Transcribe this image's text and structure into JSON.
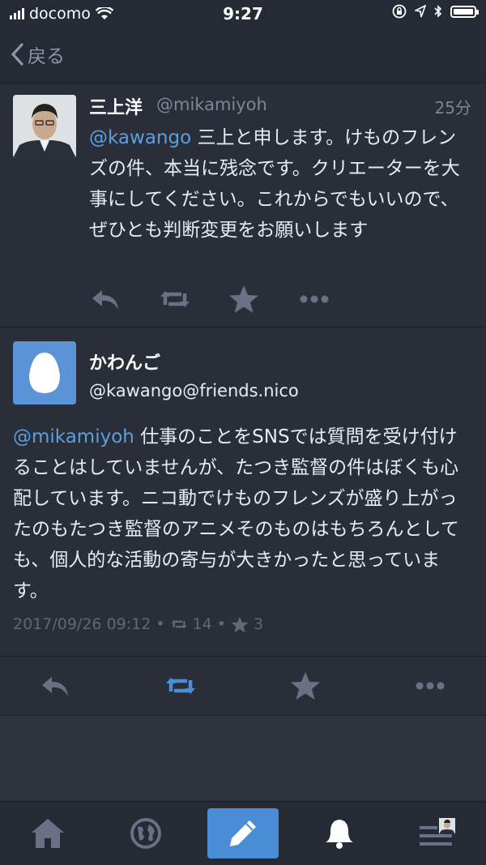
{
  "status_bar": {
    "carrier": "docomo",
    "time": "9:27"
  },
  "nav": {
    "back_label": "戻る"
  },
  "tweet1": {
    "name": "三上洋",
    "handle": "@mikamiyoh",
    "time_ago": "25分",
    "mention": "@kawango",
    "text": " 三上と申します。けものフレンズの件、本当に残念です。クリエーターを大事にしてください。これからでもいいので、ぜひとも判断変更をお願いします"
  },
  "tweet2": {
    "name": "かわんご",
    "handle": "@kawango@friends.nico",
    "mention": "@mikamiyoh",
    "text": " 仕事のことをSNSでは質問を受け付けることはしていませんが、たつき監督の件はぼくも心配しています。ニコ動でけものフレンズが盛り上がったのもたつき監督のアニメそのものはもちろんとしても、個人的な活動の寄与が大きかったと思っています。",
    "datetime": "2017/09/26 09:12",
    "boost_count": "14",
    "fav_count": "3",
    "separator": "•"
  },
  "colors": {
    "background": "#2a2e38",
    "accent": "#4a8ed8",
    "muted": "#5f6778"
  },
  "icons": [
    "signal-icon",
    "wifi-icon",
    "lock-rotation-icon",
    "location-icon",
    "bluetooth-icon",
    "battery-icon",
    "back-chevron-icon",
    "reply-icon",
    "boost-icon",
    "favourite-icon",
    "more-icon",
    "home-icon",
    "globe-icon",
    "compose-icon",
    "bell-icon",
    "menu-icon"
  ]
}
